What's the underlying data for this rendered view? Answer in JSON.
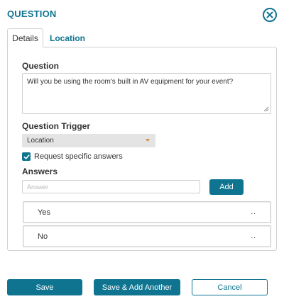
{
  "dialog": {
    "title": "QUESTION",
    "close_icon": "close-circle-icon"
  },
  "tabs": [
    {
      "label": "Details",
      "active": true
    },
    {
      "label": "Location",
      "active": false
    }
  ],
  "question": {
    "label": "Question",
    "value": "Will you be using the room's built in AV equipment for your event?"
  },
  "trigger": {
    "label": "Question Trigger",
    "selected": "Location"
  },
  "request_answers": {
    "label": "Request specific answers",
    "checked": true
  },
  "answers": {
    "label": "Answers",
    "input_placeholder": "Answer",
    "add_label": "Add",
    "items": [
      {
        "label": "Yes",
        "menu": ".."
      },
      {
        "label": "No",
        "menu": ".."
      }
    ]
  },
  "footer": {
    "save_label": "Save",
    "save_add_label": "Save & Add Another",
    "cancel_label": "Cancel"
  },
  "colors": {
    "accent": "#0e7490",
    "caret": "#e08a3c"
  }
}
